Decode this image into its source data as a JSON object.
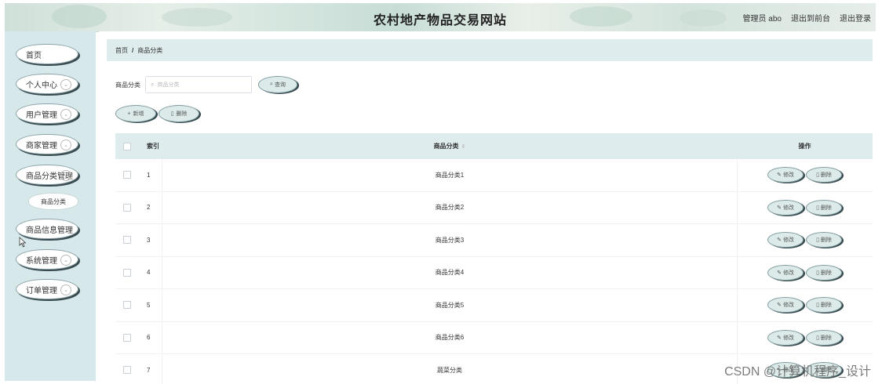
{
  "header": {
    "title": "农村地产物品交易网站",
    "admin_label": "管理员 abo",
    "to_front": "退出到前台",
    "logout": "退出登录"
  },
  "sidebar": {
    "items": [
      {
        "label": "首页"
      },
      {
        "label": "个人中心"
      },
      {
        "label": "用户管理"
      },
      {
        "label": "商家管理"
      },
      {
        "label": "商品分类管理"
      },
      {
        "label": "商品信息管理"
      },
      {
        "label": "系统管理"
      },
      {
        "label": "订单管理"
      }
    ],
    "sub_item": "商品分类",
    "chevron": "⌄"
  },
  "breadcrumb": {
    "home": "首页",
    "separator": "/",
    "current": "商品分类"
  },
  "search": {
    "label": "商品分类",
    "placeholder": "商品分类",
    "button": "查询"
  },
  "actions": {
    "add": "新增",
    "delete": "删除"
  },
  "table": {
    "headers": {
      "index": "索引",
      "name": "商品分类",
      "ops": "操作"
    },
    "rows": [
      {
        "index": "1",
        "name": "商品分类1"
      },
      {
        "index": "2",
        "name": "商品分类2"
      },
      {
        "index": "3",
        "name": "商品分类3"
      },
      {
        "index": "4",
        "name": "商品分类4"
      },
      {
        "index": "5",
        "name": "商品分类5"
      },
      {
        "index": "6",
        "name": "商品分类6"
      },
      {
        "index": "7",
        "name": "蔬菜分类"
      }
    ],
    "edit_label": "修改",
    "delete_label": "删除"
  },
  "watermark": "CSDN @计算机程序_设计",
  "colors": {
    "sidebar_bg": "#d7e8ea",
    "table_header_bg": "#dfeced",
    "button_bg": "#dcebe9"
  }
}
